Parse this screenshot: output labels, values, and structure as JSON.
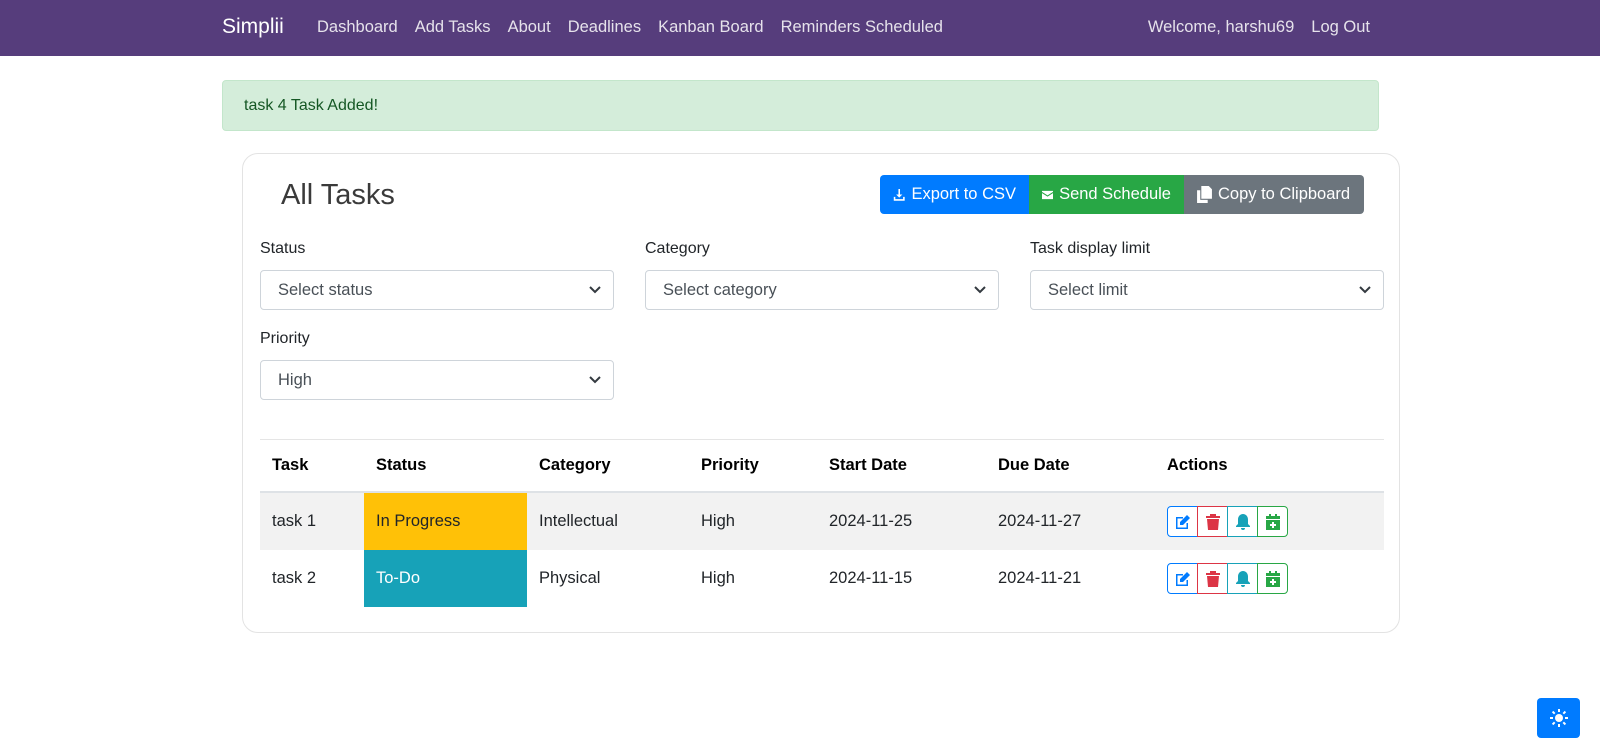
{
  "nav": {
    "brand": "Simplii",
    "links": [
      "Dashboard",
      "Add Tasks",
      "About",
      "Deadlines",
      "Kanban Board",
      "Reminders Scheduled"
    ],
    "welcome": "Welcome, harshu69",
    "logout": "Log Out"
  },
  "alert": {
    "message": "task 4 Task Added!"
  },
  "tasks_card": {
    "title": "All Tasks",
    "buttons": {
      "export": "Export to CSV",
      "send": "Send Schedule",
      "copy": "Copy to Clipboard"
    },
    "filters": {
      "status": {
        "label": "Status",
        "value": "Select status"
      },
      "category": {
        "label": "Category",
        "value": "Select category"
      },
      "limit": {
        "label": "Task display limit",
        "value": "Select limit"
      },
      "priority": {
        "label": "Priority",
        "value": "High"
      }
    },
    "table": {
      "headers": [
        "Task",
        "Status",
        "Category",
        "Priority",
        "Start Date",
        "Due Date",
        "Actions"
      ],
      "rows": [
        {
          "task": "task 1",
          "status": "In Progress",
          "category": "Intellectual",
          "priority": "High",
          "start": "2024-11-25",
          "due": "2024-11-27"
        },
        {
          "task": "task 2",
          "status": "To-Do",
          "category": "Physical",
          "priority": "High",
          "start": "2024-11-15",
          "due": "2024-11-21"
        }
      ]
    }
  },
  "icons": {
    "export": "download-icon",
    "send": "envelope-icon",
    "copy": "copy-icon",
    "edit": "edit-icon",
    "delete": "trash-icon",
    "reminder": "bell-icon",
    "calendar": "calendar-plus-icon",
    "theme": "sun-icon"
  },
  "colors": {
    "navbar": "#563d7c",
    "primary": "#007bff",
    "success": "#28a745",
    "secondary": "#6c757d",
    "danger": "#dc3545",
    "info": "#17a2b8",
    "warning": "#ffc107",
    "alert_bg": "#d4edda"
  }
}
